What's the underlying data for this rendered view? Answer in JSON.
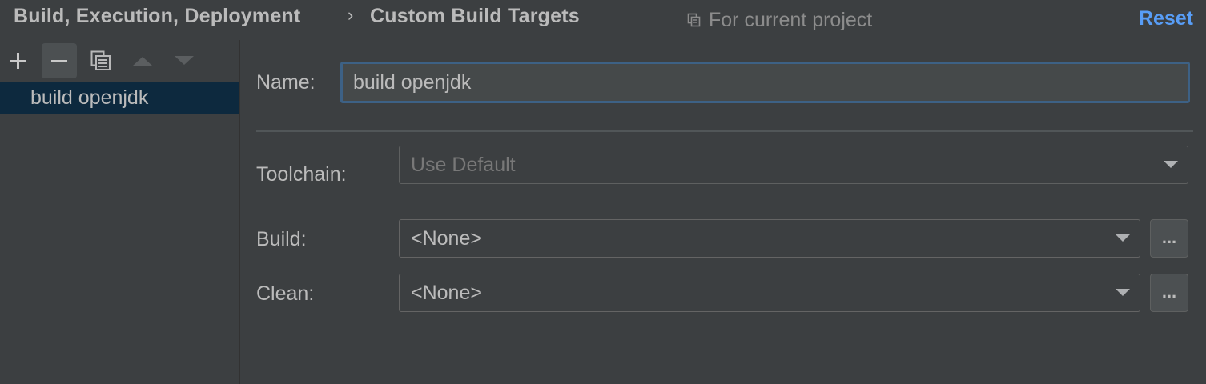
{
  "header": {
    "breadcrumb": [
      "Build, Execution, Deployment",
      "Custom Build Targets"
    ],
    "separator": "›",
    "scope_icon": "copy-scope-icon",
    "scope_text": "For current project",
    "reset_label": "Reset"
  },
  "toolbar": {
    "buttons": [
      {
        "icon": "plus-icon",
        "state": "enabled"
      },
      {
        "icon": "minus-icon",
        "state": "pressed"
      },
      {
        "icon": "copy-icon",
        "state": "enabled"
      },
      {
        "icon": "arrow-up-icon",
        "state": "disabled"
      },
      {
        "icon": "arrow-down-icon",
        "state": "disabled"
      }
    ]
  },
  "targets": {
    "items": [
      {
        "label": "build openjdk",
        "selected": true
      }
    ]
  },
  "form": {
    "name_label": "Name:",
    "name_value": "build openjdk",
    "toolchain_label": "Toolchain:",
    "toolchain_value": "Use Default",
    "build_label": "Build:",
    "build_value": "<None>",
    "clean_label": "Clean:",
    "clean_value": "<None>",
    "browse_label": "..."
  },
  "colors": {
    "background": "#3c3f41",
    "accent_link": "#589df6",
    "selection": "#0d293e",
    "focus_border": "#3d6185"
  }
}
